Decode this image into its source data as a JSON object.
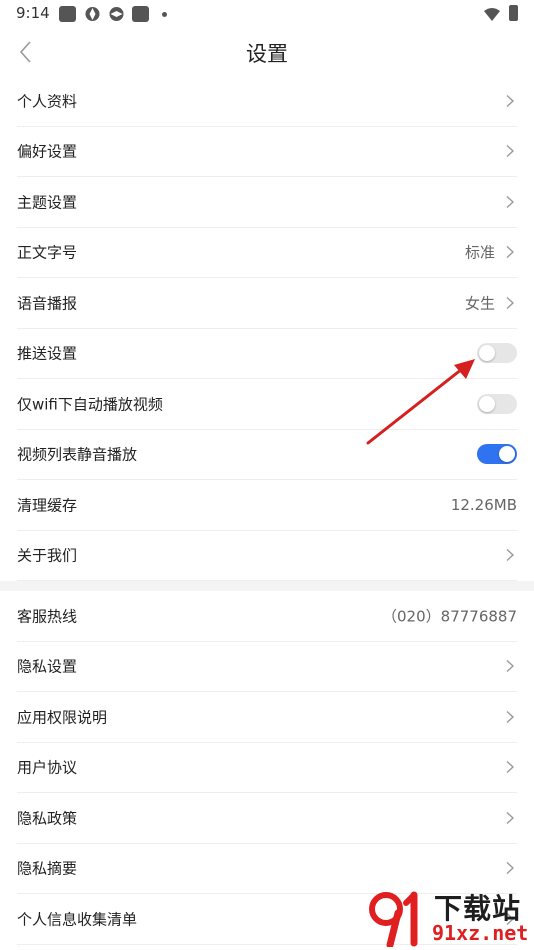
{
  "status_bar": {
    "time": "9:14"
  },
  "header": {
    "title": "设置"
  },
  "group1": [
    {
      "id": "profile",
      "label": "个人资料",
      "type": "nav"
    },
    {
      "id": "preferences",
      "label": "偏好设置",
      "type": "nav"
    },
    {
      "id": "theme",
      "label": "主题设置",
      "type": "nav"
    },
    {
      "id": "font-size",
      "label": "正文字号",
      "type": "nav",
      "value": "标准"
    },
    {
      "id": "voice",
      "label": "语音播报",
      "type": "nav",
      "value": "女生"
    },
    {
      "id": "push",
      "label": "推送设置",
      "type": "toggle",
      "on": false
    },
    {
      "id": "wifi-autoplay",
      "label": "仅wifi下自动播放视频",
      "type": "toggle",
      "on": false
    },
    {
      "id": "mute-play",
      "label": "视频列表静音播放",
      "type": "toggle",
      "on": true
    },
    {
      "id": "clear-cache",
      "label": "清理缓存",
      "type": "value",
      "value": "12.26MB"
    },
    {
      "id": "about",
      "label": "关于我们",
      "type": "nav"
    }
  ],
  "group2": [
    {
      "id": "hotline",
      "label": "客服热线",
      "type": "value",
      "value": "（020）87776887"
    },
    {
      "id": "privacy-settings",
      "label": "隐私设置",
      "type": "nav"
    },
    {
      "id": "permissions",
      "label": "应用权限说明",
      "type": "nav"
    },
    {
      "id": "user-agreement",
      "label": "用户协议",
      "type": "nav"
    },
    {
      "id": "privacy-policy",
      "label": "隐私政策",
      "type": "nav"
    },
    {
      "id": "privacy-summary",
      "label": "隐私摘要",
      "type": "nav"
    },
    {
      "id": "info-list",
      "label": "个人信息收集清单",
      "type": "nav"
    }
  ],
  "watermark": {
    "text": "下载站",
    "url": "91xz.net"
  },
  "colors": {
    "toggle_on": "#2f73f0",
    "toggle_off": "#e6e6e6",
    "arrow": "#d62020"
  }
}
